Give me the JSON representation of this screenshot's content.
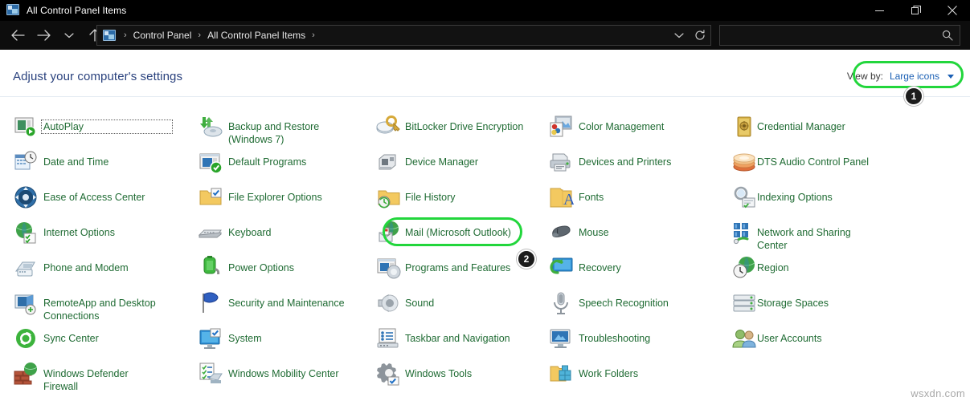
{
  "window": {
    "title": "All Control Panel Items",
    "title_icon": "control-panel-icon",
    "controls": {
      "minimize": "minimize-icon",
      "maximize": "restore-icon",
      "close": "close-icon"
    }
  },
  "nav": {
    "back": "back-arrow-icon",
    "forward": "forward-arrow-icon",
    "recent": "chevron-down-icon",
    "up": "up-arrow-icon",
    "breadcrumbs": [
      "Control Panel",
      "All Control Panel Items"
    ],
    "separator": "›",
    "dropdown": "chevron-down-icon",
    "refresh": "refresh-icon"
  },
  "search": {
    "value": "",
    "placeholder": "",
    "icon": "search-icon"
  },
  "header": {
    "page_title": "Adjust your computer's settings",
    "view_by_label": "View by:",
    "view_by_value": "Large icons",
    "view_by_caret": "chevron-down-icon"
  },
  "annotations": [
    {
      "badge": "1",
      "target": "view-by-dropdown"
    },
    {
      "badge": "2",
      "target": "mail-microsoft-outlook"
    }
  ],
  "colors": {
    "accent_green": "#22d63c",
    "item_label": "#1f6b33",
    "page_title": "#29417d",
    "link_blue": "#1a5fb4",
    "titlebar_bg": "#000000",
    "content_bg": "#ffffff"
  },
  "items": [
    {
      "label": "AutoPlay",
      "icon": "autoplay-icon",
      "col": 0,
      "row": 0,
      "focused": true
    },
    {
      "label": "Date and Time",
      "icon": "date-and-time-icon",
      "col": 0,
      "row": 1
    },
    {
      "label": "Ease of Access Center",
      "icon": "ease-of-access-center-icon",
      "col": 0,
      "row": 2
    },
    {
      "label": "Internet Options",
      "icon": "internet-options-icon",
      "col": 0,
      "row": 3
    },
    {
      "label": "Phone and Modem",
      "icon": "phone-and-modem-icon",
      "col": 0,
      "row": 4
    },
    {
      "label": "RemoteApp and Desktop\nConnections",
      "icon": "remoteapp-and-desktop-connections-icon",
      "col": 0,
      "row": 5
    },
    {
      "label": "Sync Center",
      "icon": "sync-center-icon",
      "col": 0,
      "row": 6
    },
    {
      "label": "Windows Defender\nFirewall",
      "icon": "windows-defender-firewall-icon",
      "col": 0,
      "row": 7
    },
    {
      "label": "Backup and Restore\n(Windows 7)",
      "icon": "backup-and-restore-icon",
      "col": 1,
      "row": 0
    },
    {
      "label": "Default Programs",
      "icon": "default-programs-icon",
      "col": 1,
      "row": 1
    },
    {
      "label": "File Explorer Options",
      "icon": "file-explorer-options-icon",
      "col": 1,
      "row": 2
    },
    {
      "label": "Keyboard",
      "icon": "keyboard-icon",
      "col": 1,
      "row": 3
    },
    {
      "label": "Power Options",
      "icon": "power-options-icon",
      "col": 1,
      "row": 4
    },
    {
      "label": "Security and Maintenance",
      "icon": "security-and-maintenance-icon",
      "col": 1,
      "row": 5
    },
    {
      "label": "System",
      "icon": "system-icon",
      "col": 1,
      "row": 6
    },
    {
      "label": "Windows Mobility Center",
      "icon": "windows-mobility-center-icon",
      "col": 1,
      "row": 7
    },
    {
      "label": "BitLocker Drive Encryption",
      "icon": "bitlocker-drive-encryption-icon",
      "col": 2,
      "row": 0
    },
    {
      "label": "Device Manager",
      "icon": "device-manager-icon",
      "col": 2,
      "row": 1
    },
    {
      "label": "File History",
      "icon": "file-history-icon",
      "col": 2,
      "row": 2
    },
    {
      "label": "Mail (Microsoft Outlook)",
      "icon": "mail-icon",
      "col": 2,
      "row": 3,
      "highlighted": true
    },
    {
      "label": "Programs and Features",
      "icon": "programs-and-features-icon",
      "col": 2,
      "row": 4
    },
    {
      "label": "Sound",
      "icon": "sound-icon",
      "col": 2,
      "row": 5
    },
    {
      "label": "Taskbar and Navigation",
      "icon": "taskbar-and-navigation-icon",
      "col": 2,
      "row": 6
    },
    {
      "label": "Windows Tools",
      "icon": "windows-tools-icon",
      "col": 2,
      "row": 7
    },
    {
      "label": "Color Management",
      "icon": "color-management-icon",
      "col": 3,
      "row": 0
    },
    {
      "label": "Devices and Printers",
      "icon": "devices-and-printers-icon",
      "col": 3,
      "row": 1
    },
    {
      "label": "Fonts",
      "icon": "fonts-icon",
      "col": 3,
      "row": 2
    },
    {
      "label": "Mouse",
      "icon": "mouse-icon",
      "col": 3,
      "row": 3
    },
    {
      "label": "Recovery",
      "icon": "recovery-icon",
      "col": 3,
      "row": 4
    },
    {
      "label": "Speech Recognition",
      "icon": "speech-recognition-icon",
      "col": 3,
      "row": 5
    },
    {
      "label": "Troubleshooting",
      "icon": "troubleshooting-icon",
      "col": 3,
      "row": 6
    },
    {
      "label": "Work Folders",
      "icon": "work-folders-icon",
      "col": 3,
      "row": 7
    },
    {
      "label": "Credential Manager",
      "icon": "credential-manager-icon",
      "col": 4,
      "row": 0
    },
    {
      "label": "DTS Audio Control Panel",
      "icon": "dts-audio-control-panel-icon",
      "col": 4,
      "row": 1
    },
    {
      "label": "Indexing Options",
      "icon": "indexing-options-icon",
      "col": 4,
      "row": 2
    },
    {
      "label": "Network and Sharing\nCenter",
      "icon": "network-and-sharing-center-icon",
      "col": 4,
      "row": 3
    },
    {
      "label": "Region",
      "icon": "region-icon",
      "col": 4,
      "row": 4
    },
    {
      "label": "Storage Spaces",
      "icon": "storage-spaces-icon",
      "col": 4,
      "row": 5
    },
    {
      "label": "User Accounts",
      "icon": "user-accounts-icon",
      "col": 4,
      "row": 6
    }
  ],
  "watermark": "wsxdn.com"
}
